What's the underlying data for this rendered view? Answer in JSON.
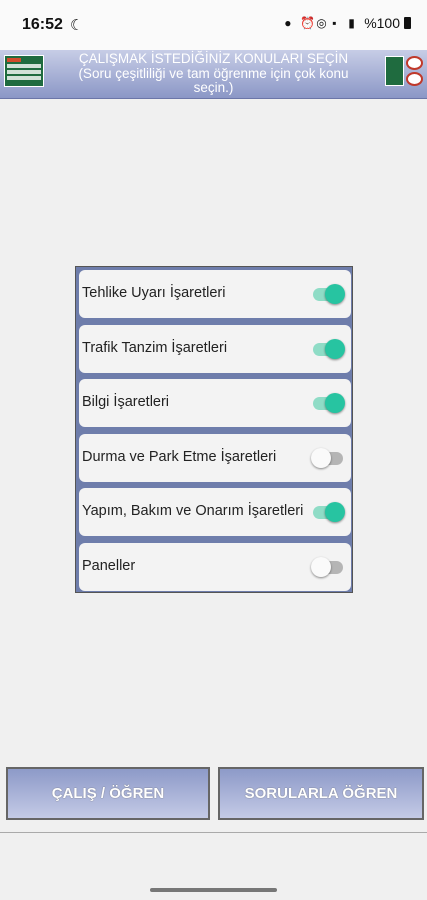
{
  "status_bar": {
    "time": "16:52",
    "battery_text": "%100"
  },
  "header": {
    "title": "ÇALIŞMAK İSTEDİĞİNİZ KONULARI SEÇİN",
    "subtitle_line1": "(Soru çeşitliliği ve tam öğrenme için çok konu",
    "subtitle_line2": "seçin.)"
  },
  "topics": [
    {
      "label": "Tehlike Uyarı İşaretleri",
      "enabled": true
    },
    {
      "label": "Trafik Tanzim İşaretleri",
      "enabled": true
    },
    {
      "label": "Bilgi İşaretleri",
      "enabled": true
    },
    {
      "label": "Durma ve Park Etme İşaretleri",
      "enabled": false
    },
    {
      "label": "Yapım, Bakım ve Onarım İşaretleri",
      "enabled": true
    },
    {
      "label": "Paneller",
      "enabled": false
    }
  ],
  "buttons": {
    "study_label": "ÇALIŞ / ÖĞREN",
    "quiz_label": "SORULARLA ÖĞREN"
  },
  "colors": {
    "accent_switch_on": "#27c4a1",
    "panel_background": "#6e7dab"
  }
}
